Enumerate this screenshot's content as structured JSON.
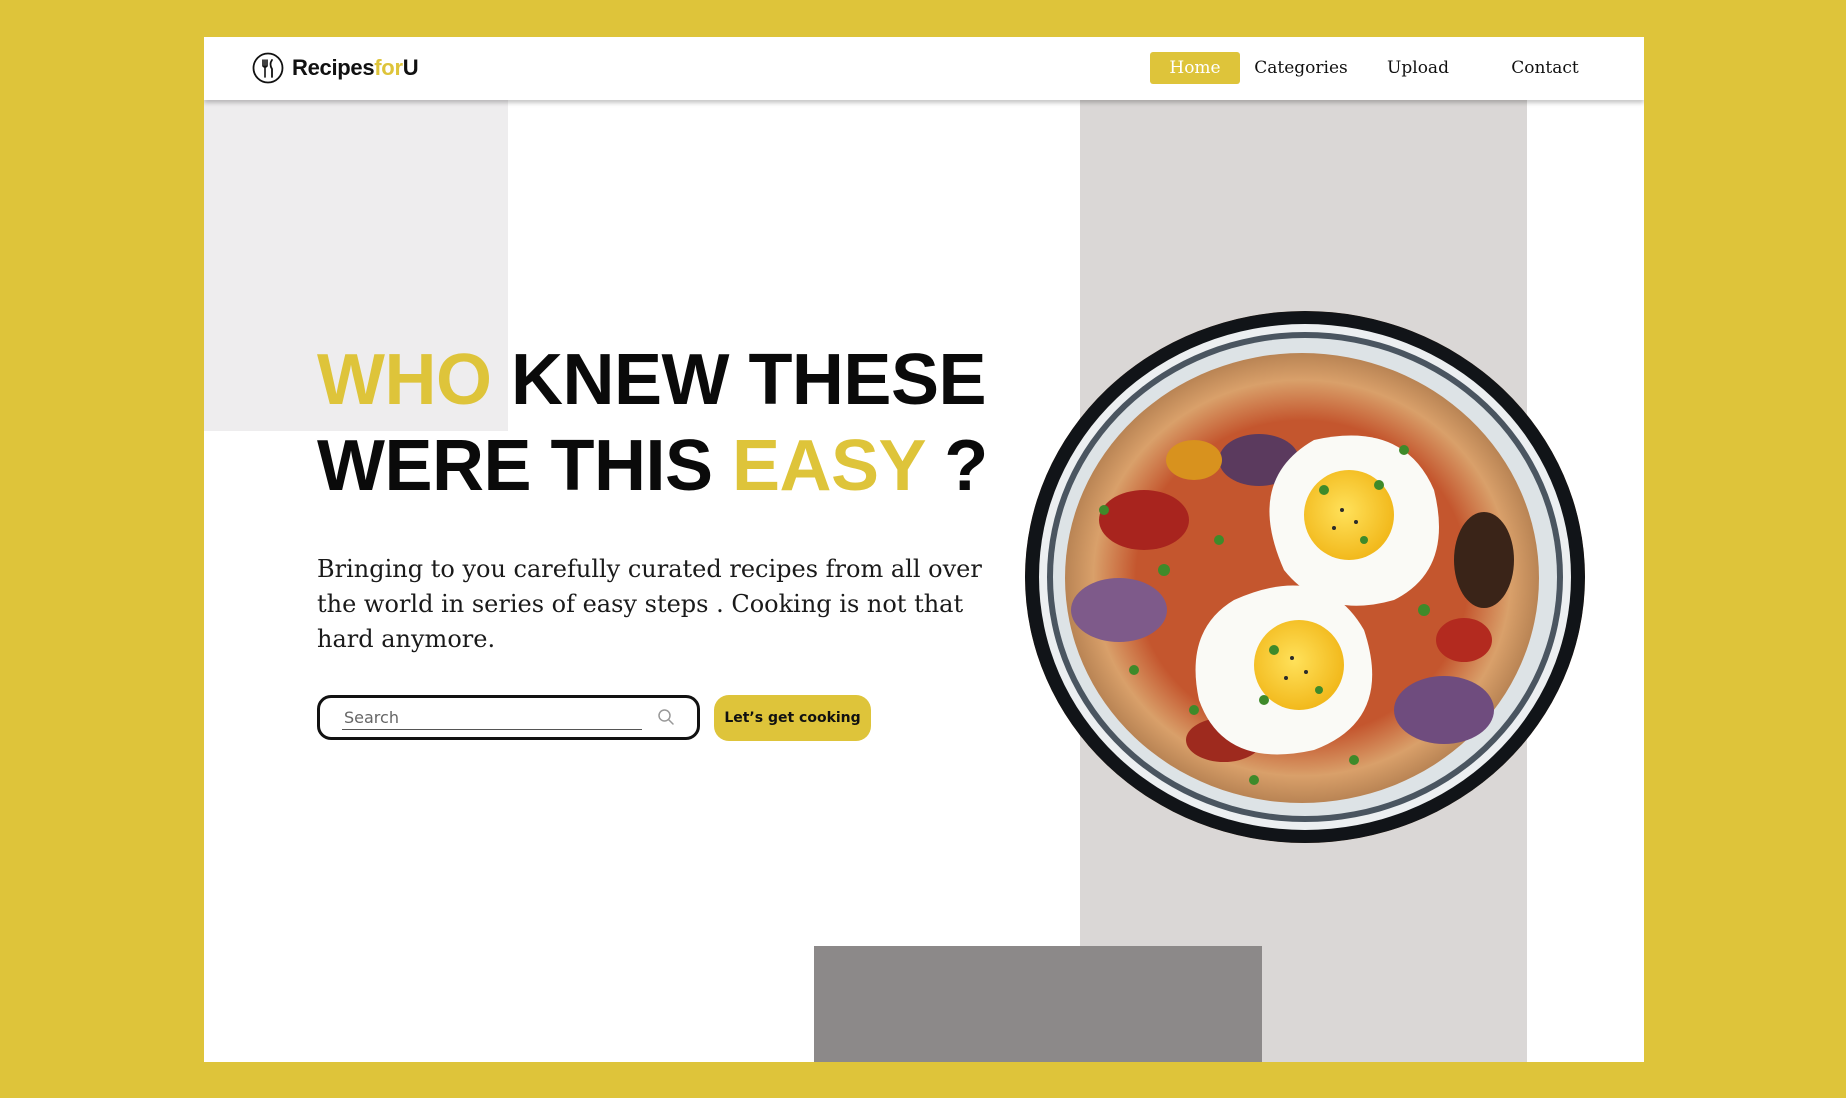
{
  "brand": {
    "name_main": "Recipes",
    "name_accent": "for",
    "name_end": "U",
    "icon": "fork-knife-icon"
  },
  "nav": {
    "items": [
      {
        "label": "Home",
        "active": true
      },
      {
        "label": "Categories",
        "active": false
      },
      {
        "label": "Upload",
        "active": false
      },
      {
        "label": "Contact",
        "active": false
      }
    ]
  },
  "hero": {
    "headline_part1_accent": "WHO",
    "headline_part2": " KNEW THESE",
    "headline_part3": "WERE THIS ",
    "headline_part4_accent": "EASY",
    "headline_part5": " ?",
    "subtext": "Bringing to you carefully curated recipes from all over the world in series of easy steps . Cooking is not that hard anymore.",
    "search_placeholder": "Search",
    "cta_label": "Let’s get cooking",
    "image": "pizza-with-fried-eggs-in-pan"
  },
  "colors": {
    "accent": "#DEC43A",
    "background": "#DEC43A",
    "panel_light": "#EEEDEE",
    "panel_gray": "#DAD7D6",
    "panel_dark": "#8C8989",
    "text": "#0A0A0A"
  }
}
